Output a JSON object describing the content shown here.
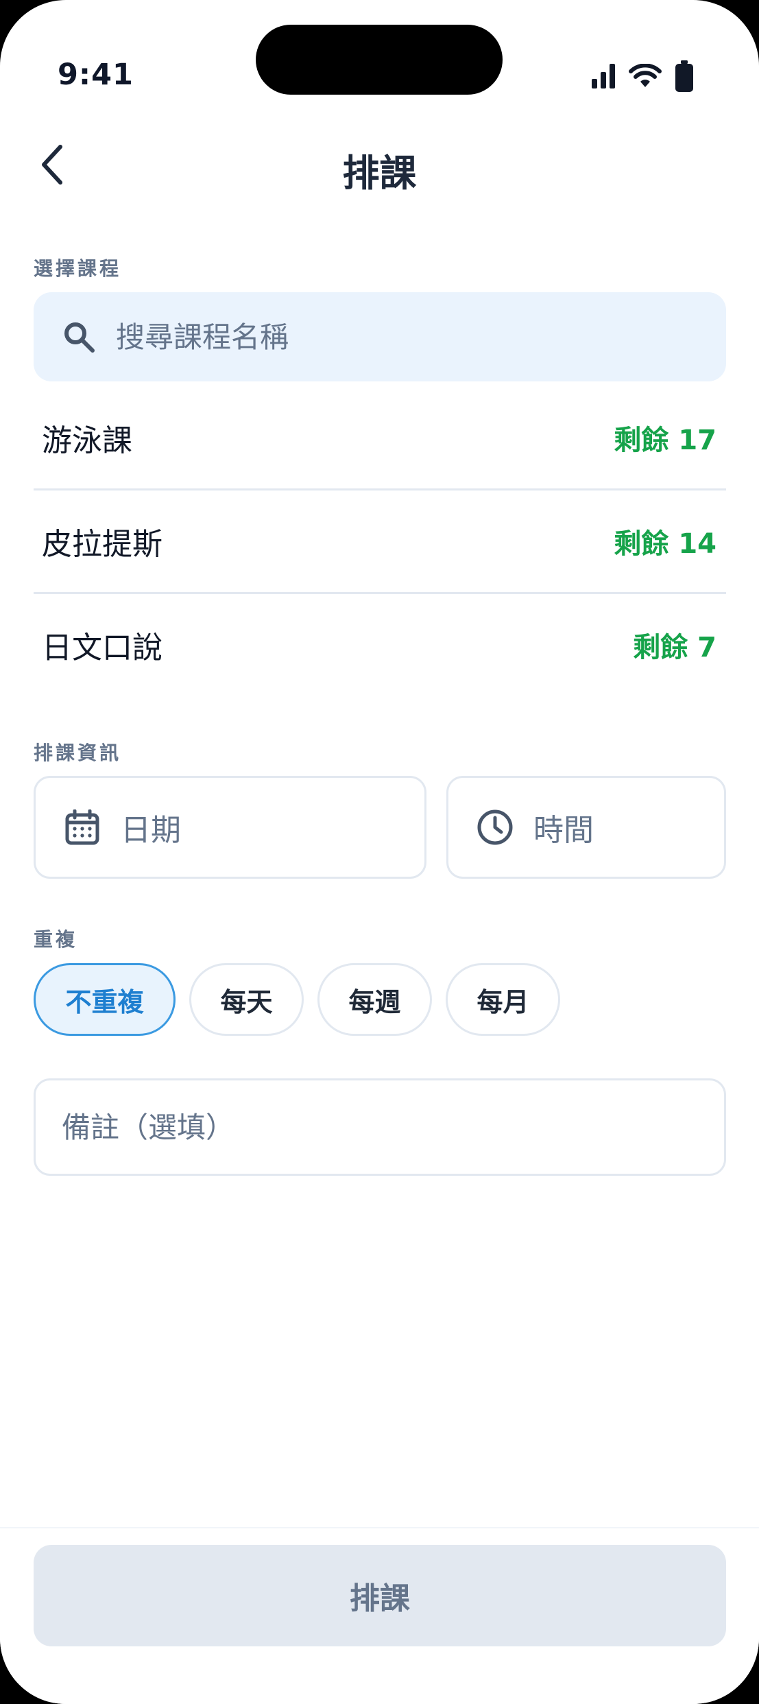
{
  "status_bar": {
    "time": "9:41"
  },
  "nav": {
    "title": "排課"
  },
  "course_section": {
    "label": "選擇課程",
    "search_placeholder": "搜尋課程名稱",
    "courses": [
      {
        "name": "游泳課",
        "remaining": "剩餘 17"
      },
      {
        "name": "皮拉提斯",
        "remaining": "剩餘 14"
      },
      {
        "name": "日文口說",
        "remaining": "剩餘 7"
      }
    ]
  },
  "schedule_section": {
    "label": "排課資訊",
    "date_label": "日期",
    "time_label": "時間"
  },
  "repeat_section": {
    "label": "重複",
    "options": [
      "不重複",
      "每天",
      "每週",
      "每月"
    ],
    "selected": "不重複"
  },
  "note": {
    "placeholder": "備註（選填）"
  },
  "submit_label": "排課",
  "colors": {
    "accent": "#1e7fd0",
    "remaining": "#16a34a",
    "search_bg": "#eaf3fd",
    "disabled_button": "#e2e8f0"
  }
}
